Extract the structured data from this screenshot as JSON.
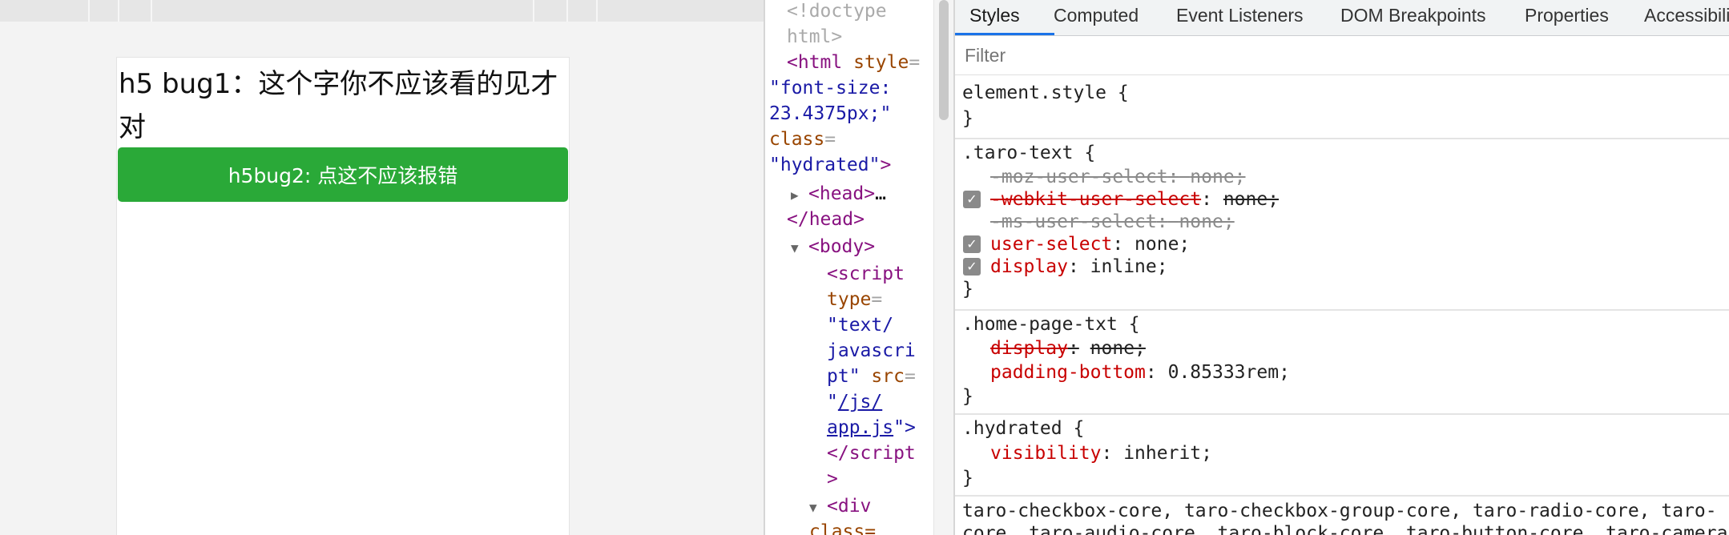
{
  "preview": {
    "h5_text": "h5 bug1：这个字你不应该看的见才对",
    "h5_button_label": "h5bug2: 点这不应该报错"
  },
  "dom_tree": {
    "doctype": "<!doctype",
    "doctype_2": "html>",
    "html_tag": "<html",
    "html_style_attr": "style",
    "html_style_val_1": "\"font-size:",
    "html_style_val_2": "23.4375px;\"",
    "html_class_attr": "class",
    "html_class_val": "\"hydrated\"",
    "head_tag": "<head>",
    "head_ellipsis": "…",
    "head_close": "</head>",
    "body_tag": "<body>",
    "script_open": "<script",
    "type_attr": "type",
    "type_val_1": "\"text/",
    "type_val_2": "javascri",
    "type_val_3": "pt\"",
    "src_attr": "src",
    "src_quote_open": "\"",
    "src_link_1": "/js/",
    "src_link_2": "app.js",
    "src_quote_close": "\">",
    "script_close": "</script",
    "script_close_2": ">",
    "div_tag": "<div",
    "div_class_attr": "class="
  },
  "styles_panel": {
    "tabs": [
      "Styles",
      "Computed",
      "Event Listeners",
      "DOM Breakpoints",
      "Properties",
      "Accessibility"
    ],
    "active_tab": "Styles",
    "filter_placeholder": "Filter",
    "rules": {
      "element_style": {
        "selector": "element.style",
        "open": "{",
        "close": "}"
      },
      "taro_text": {
        "selector": ".taro-text",
        "open": "{",
        "close": "}",
        "decls": [
          {
            "name": "-moz-user-select",
            "value": "none;"
          },
          {
            "name": "-webkit-user-select",
            "value": "none;"
          },
          {
            "name": "-ms-user-select",
            "value": "none;"
          },
          {
            "name": "user-select",
            "value": "none;"
          },
          {
            "name": "display",
            "value": "inline;"
          }
        ]
      },
      "home_page_txt": {
        "selector": ".home-page-txt",
        "open": "{",
        "close": "}",
        "decls": [
          {
            "name": "display",
            "value": "none;"
          },
          {
            "name": "padding-bottom",
            "value": "0.85333rem;"
          }
        ]
      },
      "hydrated": {
        "selector": ".hydrated",
        "open": "{",
        "close": "}",
        "decls": [
          {
            "name": "visibility",
            "value": "inherit;"
          }
        ]
      },
      "core_list": {
        "line_1": "taro-checkbox-core, taro-checkbox-group-core, taro-radio-core, taro-",
        "line_2": "core, taro-audio-core, taro-block-core, taro-button-core, taro-camera"
      }
    },
    "punct": {
      "colon": ":"
    }
  },
  "colors": {
    "button_green": "#2aa938",
    "tab_active_underline": "#1a73e8",
    "property_name": "#c80000",
    "tag": "#881280",
    "attr": "#994500",
    "attr_value": "#1a1aa6"
  }
}
